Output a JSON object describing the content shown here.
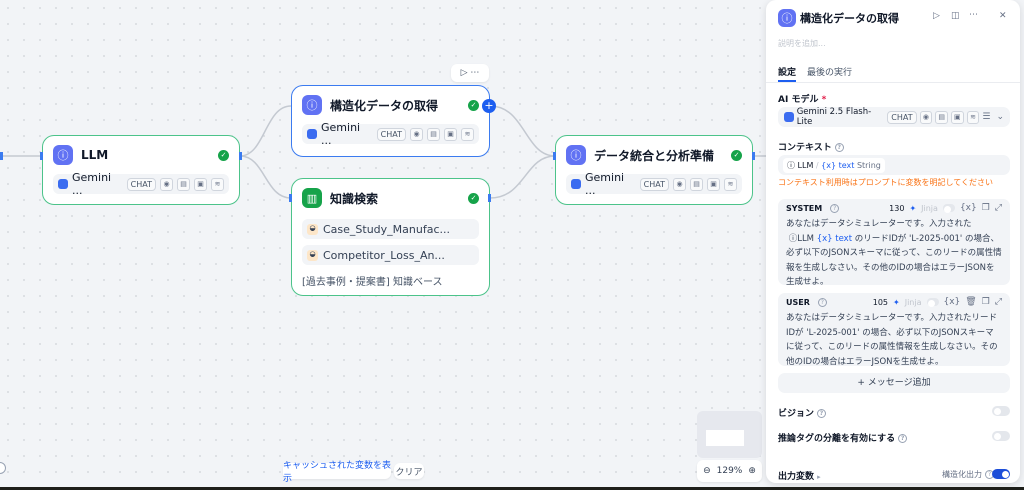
{
  "nodes": {
    "llm": {
      "title": "LLM",
      "model": "Gemini ...",
      "tag": "CHAT"
    },
    "structured": {
      "title": "構造化データの取得",
      "model": "Gemini ...",
      "tag": "CHAT"
    },
    "knowledge": {
      "title": "知識検索",
      "items": [
        "Case_Study_Manufac...",
        "Competitor_Loss_An..."
      ],
      "footer": "[過去事例・提案書] 知識ベース"
    },
    "integrate": {
      "title": "データ統合と分析準備",
      "model": "Gemini ...",
      "tag": "CHAT"
    }
  },
  "canvas": {
    "show_cached": "キャッシュされた変数を表示",
    "clear": "クリア",
    "zoom": "129%"
  },
  "panel": {
    "title": "構造化データの取得",
    "description_placeholder": "説明を追加...",
    "tabs": [
      "設定",
      "最後の実行"
    ],
    "ai_model_label": "AI モデル",
    "required_mark": "*",
    "model_name": "Gemini 2.5 Flash-Lite",
    "model_tag": "CHAT",
    "context_label": "コンテキスト",
    "context_node": "LLM",
    "context_var": "{x} text",
    "context_type": "String",
    "context_warning": "コンテキスト利用時はプロンプトに変数を明記してください",
    "system": {
      "role": "SYSTEM",
      "count": "130",
      "jinja": "Jinja",
      "var_btn": "{x}",
      "text1": "あなたはデータシミュレーターです。入力された",
      "ref_node": "LLM",
      "ref_var": "{x} text",
      "text2": "のリードIDが 'L-2025-001' の場合、必ず以下のJSONスキーマに従って、このリードの属性情報を生成しなさい。その他のIDの場合はエラーJSONを生成せよ。"
    },
    "user": {
      "role": "USER",
      "count": "105",
      "jinja": "Jinja",
      "var_btn": "{x}",
      "text": "あなたはデータシミュレーターです。入力されたリードIDが 'L-2025-001' の場合、必ず以下のJSONスキーマに従って、このリードの属性情報を生成しなさい。その他のIDの場合はエラーJSONを生成せよ。"
    },
    "add_message": "+ メッセージ追加",
    "vision_label": "ビジョン",
    "vision_on": false,
    "reasoning_label": "推論タグの分離を有効にする",
    "reasoning_on": false,
    "output_vars": "出力変数",
    "structured_output": "構造化出力",
    "structured_output_on": true
  },
  "colors": {
    "accent": "#3b7bf0",
    "success": "#16a34a",
    "warning": "#f97316",
    "node_icon": "#6172f3"
  }
}
